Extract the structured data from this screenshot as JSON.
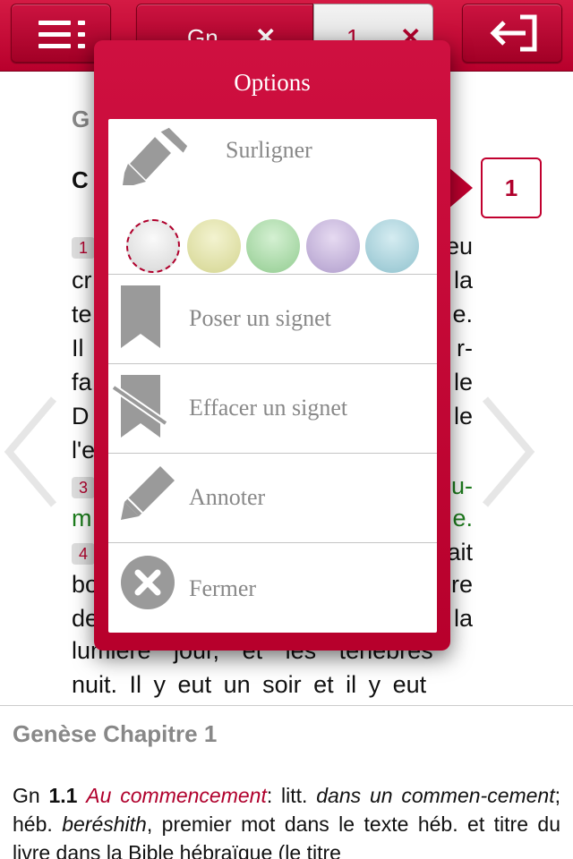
{
  "toolbar": {
    "book_value": "Gn",
    "chapter_value": "1"
  },
  "reader": {
    "book_heading": "G",
    "chapter_heading": "C",
    "lines": [
      {
        "left": "",
        "right": ""
      },
      {
        "left": "cr",
        "right": "la"
      },
      {
        "left": "te",
        "right": "e."
      },
      {
        "left": "Il",
        "right": "r-"
      },
      {
        "left": "fa",
        "right": "le"
      },
      {
        "left": "D",
        "right": "le"
      },
      {
        "left": "l'e",
        "right": ""
      }
    ],
    "v1_tail": "eu",
    "v3_tail": "u-",
    "v3_line2_left": "m",
    "v3_line2_right": "e.",
    "v4_tail": "ait",
    "v4_l2_left": "bo",
    "v4_l2_right": "re",
    "v4_l3_left": "de",
    "v4_l3_right": "la",
    "line_lumiere": "lumière jour, et les ténèbres",
    "line_nuit": "nuit. Il y eut un soir et il y eut",
    "verse_numbers": [
      "1",
      "3",
      "4"
    ],
    "page_badge": "1"
  },
  "notes": {
    "title": "Genèse Chapitre 1",
    "ref_book": "Gn ",
    "ref_num": "1.1",
    "ref_term": "Au commencement",
    "text_1": ": litt. ",
    "text_2": "dans un commen-cement",
    "text_3": "; héb. ",
    "text_4": "beréshith",
    "text_5": ", premier mot dans le texte héb. et titre du livre dans la Bible hébraïque (le titre"
  },
  "popover": {
    "title": "Options",
    "highlight_label": "Surligner",
    "swatch_colors": [
      "#e8e8e8",
      "#e3e4a6",
      "#a9dca8",
      "#c7b5dc",
      "#a8d4de"
    ],
    "set_bookmark_label": "Poser un signet",
    "remove_bookmark_label": "Effacer un signet",
    "annotate_label": "Annoter",
    "close_label": "Fermer"
  },
  "colors": {
    "brand": "#c1002f",
    "option_gray": "#999999"
  }
}
